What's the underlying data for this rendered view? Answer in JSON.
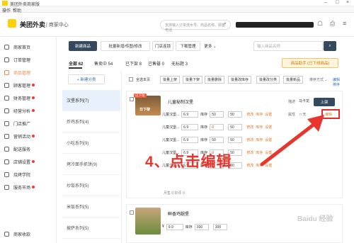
{
  "window_title": "美团外卖商家版",
  "menu": [
    "操作",
    "帮助"
  ],
  "brand": {
    "name": "美团外卖",
    "sub": "| 商家中心",
    "accent": "#ffd100"
  },
  "search_placeholder": "支持输入订单流水号、商品名称、顾客电话",
  "sidebar": [
    "商家首页",
    "订单管理",
    "商品管理",
    "顾客管理",
    "财务管理",
    "经营分析",
    "门店推广",
    "营销活动",
    "配送服务",
    "店铺设置",
    "烧烤学院",
    "服务市场",
    "商家收款"
  ],
  "toolbar": {
    "new": "新建商品",
    "batch": "批量新增/传图/修改",
    "storetpl": "门店连锁",
    "download": "下载管理",
    "more": "更多 ⌄",
    "search_placeholder": "输入商品名称"
  },
  "tabs": {
    "all": "全部 62",
    "selling": "售卖中 54",
    "off": "已下架 8",
    "sold_out": "已售罄 0",
    "no_img": "无标题 3"
  },
  "promo": "商品助手 (已下线商品)",
  "actions": {
    "select_all": "全选本页",
    "batch_on": "批量上架",
    "batch_off": "批量下架",
    "batch_del": "批量删除",
    "batch_price": "批量改库存",
    "batch_cat": "批量改分类",
    "batch_new": "批量新品",
    "sort": "排序方式 ⌄",
    "edit_sort": "编辑排序"
  },
  "add_category": "+ 新建分类",
  "categories": [
    "汉堡系列(7)",
    "炸鸡系列(4)",
    "小吃系列(9)",
    "烤冷面手抓饼(9)",
    "炒饭系列(5)",
    "米饭系列(5)",
    "披萨系列(5)"
  ],
  "product1": {
    "badge": "已下架",
    "name": "儿童秘制汉堡",
    "image_label": "日下架",
    "desc": "描述",
    "stock_label": "库存",
    "price_label": "价格",
    "action1": "上架",
    "action2": "编辑",
    "time": "月售 0  好评 0",
    "skus": [
      {
        "name": "儿童汉堡...",
        "price": "6.9",
        "stock": "50",
        "cap": "50"
      },
      {
        "name": "儿童汉堡...",
        "price": "6.9",
        "stock": "0",
        "cap": "50"
      },
      {
        "name": "儿童汉堡...",
        "price": "6.9",
        "stock": "50",
        "cap": "50"
      },
      {
        "name": "儿童汉堡...",
        "price": "6.9",
        "stock": "0",
        "cap": "50"
      },
      {
        "name": "儿童汉堡...",
        "price": "6.9",
        "stock": "0",
        "cap": "50"
      }
    ],
    "links": [
      "修改",
      "库存",
      "设置"
    ]
  },
  "product2": {
    "name": "鲜香鸡腿堡",
    "price": "9.9",
    "stock": "300",
    "cap": "300"
  },
  "annotation": "4、点击编辑",
  "annotation_color": "#e8362e",
  "watermark": "Baidu 经验"
}
